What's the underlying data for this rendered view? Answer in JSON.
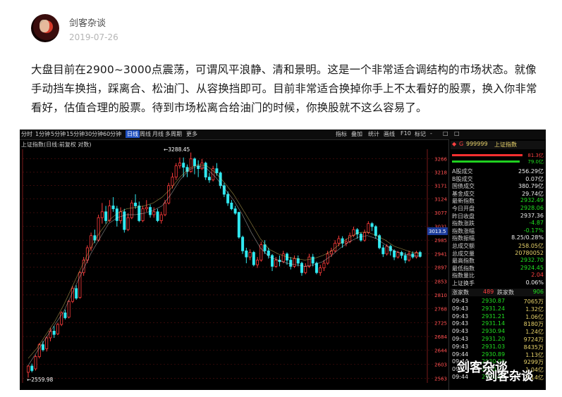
{
  "post": {
    "author": "剑客杂谈",
    "date": "2019-07-26",
    "paragraph": "大盘目前在2900~3000点震荡，可谓风平浪静、清和景明。这是一个非常适合调结构的市场状态。就像手动挡车换挡，踩离合、松油门、从容换挡即可。目前非常适合换掉你手上不太看好的股票，换入你非常看好，估值合理的股票。待到市场松离合给油门的时候，你换股就不这么容易了。"
  },
  "terminal": {
    "tabs": [
      "分时",
      "1分钟",
      "5分钟",
      "15分钟",
      "30分钟",
      "60分钟",
      "日线",
      "周线",
      "月线",
      "多周期",
      "更多"
    ],
    "active_tab": "日线",
    "right_tabs": [
      "指标",
      "叠加",
      "统计",
      "画线",
      "F10",
      "标记",
      "-",
      "□",
      "□"
    ],
    "subtitle": "上证指数(日线:前复权 对数)",
    "high_label": "3288.45",
    "low_label": "2559.98",
    "current_price_label": "3013.5",
    "y_axis_labels": [
      "3266",
      "3218",
      "3171",
      "3124",
      "3077",
      "3031",
      "2985",
      "2941",
      "2897",
      "2853",
      "2810",
      "2768",
      "2725",
      "2684",
      "2644",
      "2603",
      "2563"
    ],
    "panel": {
      "code": "999999",
      "name": "上证指数",
      "ratio_red": "81.3亿",
      "ratio_green": "79.0亿",
      "rows": [
        {
          "label": "A股成交",
          "value": "256.29亿",
          "color": "#f0f0f0"
        },
        {
          "label": "B股成交",
          "value": "0.07亿",
          "color": "#f0f0f0"
        },
        {
          "label": "国债成交",
          "value": "380.79亿",
          "color": "#f0f0f0"
        },
        {
          "label": "基金成交",
          "value": "29.74亿",
          "color": "#f0f0f0"
        },
        {
          "label": "最新指数",
          "value": "2932.49",
          "color": "#20e020"
        },
        {
          "label": "今日开盘",
          "value": "2928.06",
          "color": "#20e020"
        },
        {
          "label": "昨日收盘",
          "value": "2937.36",
          "color": "#f0f0f0"
        },
        {
          "label": "指数涨跌",
          "value": "-4.87",
          "color": "#20e020"
        },
        {
          "label": "指数涨幅",
          "value": "-0.17%",
          "color": "#20e020"
        },
        {
          "label": "指数振幅",
          "value": "8.25/0.28%",
          "color": "#f0f0f0"
        },
        {
          "label": "总成交额",
          "value": "258.05亿",
          "color": "#e9d36a"
        },
        {
          "label": "总成交量",
          "value": "20780052",
          "color": "#e9d36a"
        },
        {
          "label": "最高指数",
          "value": "2932.70",
          "color": "#20e020"
        },
        {
          "label": "最低指数",
          "value": "2924.45",
          "color": "#20e020"
        },
        {
          "label": "指数量比",
          "value": "2.04",
          "color": "#ff4040"
        },
        {
          "label": "上证换手",
          "value": "0.06%",
          "color": "#f0f0f0"
        }
      ],
      "updown": {
        "up_label": "涨家数",
        "up": "489",
        "down_label": "跌家数",
        "down": "906"
      },
      "ticks": [
        {
          "t": "09:43",
          "p": "2930.87",
          "v": "7065万"
        },
        {
          "t": "09:43",
          "p": "2931.24",
          "v": "1.32亿"
        },
        {
          "t": "09:43",
          "p": "2931.21",
          "v": "1.06亿"
        },
        {
          "t": "09:43",
          "p": "2931.14",
          "v": "8180万"
        },
        {
          "t": "09:43",
          "p": "2930.94",
          "v": "1.24亿"
        },
        {
          "t": "09:43",
          "p": "2931.20",
          "v": "9724万"
        },
        {
          "t": "09:43",
          "p": "2931.03",
          "v": "8435万"
        },
        {
          "t": "09:44",
          "p": "2930.89",
          "v": "1.13亿"
        },
        {
          "t": "09:44",
          "p": "2930.98",
          "v": "9299万"
        },
        {
          "t": "09:44",
          "p": "2930.91",
          "v": "1.04亿"
        },
        {
          "t": "09:44",
          "p": "2930.97",
          "v": "1.14亿"
        }
      ]
    },
    "candles": [
      [
        2580,
        2598,
        2565,
        2600
      ],
      [
        2598,
        2585,
        2580,
        2605
      ],
      [
        2590,
        2625,
        2585,
        2630
      ],
      [
        2625,
        2660,
        2620,
        2665
      ],
      [
        2660,
        2645,
        2640,
        2670
      ],
      [
        2648,
        2680,
        2640,
        2685
      ],
      [
        2680,
        2700,
        2670,
        2710
      ],
      [
        2700,
        2690,
        2680,
        2715
      ],
      [
        2692,
        2720,
        2688,
        2725
      ],
      [
        2720,
        2755,
        2715,
        2760
      ],
      [
        2755,
        2740,
        2735,
        2765
      ],
      [
        2742,
        2790,
        2738,
        2795
      ],
      [
        2790,
        2830,
        2785,
        2838
      ],
      [
        2830,
        2800,
        2795,
        2840
      ],
      [
        2802,
        2880,
        2798,
        2885
      ],
      [
        2880,
        2920,
        2870,
        2930
      ],
      [
        2920,
        2960,
        2910,
        2968
      ],
      [
        2960,
        3000,
        2950,
        3010
      ],
      [
        3000,
        2985,
        2975,
        3020
      ],
      [
        2985,
        3060,
        2980,
        3070
      ],
      [
        3060,
        3080,
        3040,
        3110
      ],
      [
        3080,
        3050,
        3040,
        3100
      ],
      [
        3050,
        3100,
        3045,
        3120
      ],
      [
        3100,
        3090,
        3080,
        3130
      ],
      [
        3090,
        3050,
        3030,
        3100
      ],
      [
        3050,
        3080,
        3040,
        3095
      ],
      [
        3080,
        3020,
        3010,
        3090
      ],
      [
        3020,
        3060,
        3015,
        3075
      ],
      [
        3060,
        3110,
        3055,
        3120
      ],
      [
        3110,
        3100,
        3090,
        3140
      ],
      [
        3100,
        3050,
        3045,
        3115
      ],
      [
        3050,
        3090,
        3045,
        3100
      ],
      [
        3090,
        3095,
        3080,
        3120
      ],
      [
        3095,
        3070,
        3060,
        3105
      ],
      [
        3070,
        3080,
        3060,
        3095
      ],
      [
        3080,
        3050,
        3045,
        3090
      ],
      [
        3050,
        3070,
        3040,
        3080
      ],
      [
        3070,
        3110,
        3065,
        3120
      ],
      [
        3110,
        3170,
        3105,
        3180
      ],
      [
        3170,
        3200,
        3160,
        3215
      ],
      [
        3200,
        3240,
        3190,
        3250
      ],
      [
        3240,
        3250,
        3230,
        3270
      ],
      [
        3250,
        3235,
        3200,
        3270
      ],
      [
        3235,
        3220,
        3200,
        3245
      ],
      [
        3220,
        3265,
        3215,
        3288
      ],
      [
        3265,
        3240,
        3210,
        3270
      ],
      [
        3240,
        3230,
        3200,
        3260
      ],
      [
        3230,
        3250,
        3225,
        3265
      ],
      [
        3250,
        3200,
        3190,
        3255
      ],
      [
        3200,
        3190,
        3180,
        3215
      ],
      [
        3190,
        3230,
        3185,
        3240
      ],
      [
        3230,
        3215,
        3205,
        3250
      ],
      [
        3215,
        3170,
        3160,
        3220
      ],
      [
        3170,
        3140,
        3130,
        3180
      ],
      [
        3140,
        3110,
        3100,
        3150
      ],
      [
        3110,
        3090,
        3085,
        3120
      ],
      [
        3090,
        3075,
        3070,
        3100
      ],
      [
        3078,
        2995,
        2990,
        3080
      ],
      [
        2995,
        2950,
        2940,
        3000
      ],
      [
        2950,
        2930,
        2910,
        2960
      ],
      [
        2930,
        2945,
        2920,
        2955
      ],
      [
        2945,
        2905,
        2900,
        2950
      ],
      [
        2905,
        2920,
        2895,
        2930
      ],
      [
        2920,
        2970,
        2915,
        2980
      ],
      [
        2970,
        2950,
        2940,
        2985
      ],
      [
        2950,
        2935,
        2925,
        2960
      ],
      [
        2935,
        2900,
        2885,
        2940
      ],
      [
        2900,
        2920,
        2895,
        2930
      ],
      [
        2920,
        2915,
        2900,
        2935
      ],
      [
        2915,
        2940,
        2910,
        2950
      ],
      [
        2940,
        2920,
        2905,
        2945
      ],
      [
        2920,
        2900,
        2890,
        2930
      ],
      [
        2900,
        2925,
        2895,
        2935
      ],
      [
        2925,
        2910,
        2900,
        2935
      ],
      [
        2910,
        2880,
        2870,
        2915
      ],
      [
        2880,
        2900,
        2875,
        2910
      ],
      [
        2900,
        2930,
        2895,
        2940
      ],
      [
        2930,
        2910,
        2900,
        2940
      ],
      [
        2910,
        2880,
        2875,
        2915
      ],
      [
        2880,
        2895,
        2870,
        2905
      ],
      [
        2895,
        2910,
        2885,
        2920
      ],
      [
        2910,
        2940,
        2905,
        2950
      ],
      [
        2940,
        2950,
        2930,
        2960
      ],
      [
        2950,
        2975,
        2945,
        2985
      ],
      [
        2975,
        2990,
        2965,
        3000
      ],
      [
        2990,
        2975,
        2960,
        2998
      ],
      [
        2975,
        2980,
        2965,
        2990
      ],
      [
        2980,
        3000,
        2975,
        3010
      ],
      [
        3000,
        3020,
        2995,
        3030
      ],
      [
        3020,
        3005,
        2990,
        3025
      ],
      [
        3005,
        2985,
        2980,
        3010
      ],
      [
        2985,
        3010,
        2980,
        3020
      ],
      [
        3010,
        3040,
        3005,
        3048
      ],
      [
        3040,
        3030,
        3015,
        3045
      ],
      [
        3030,
        3000,
        2990,
        3035
      ],
      [
        3000,
        2960,
        2955,
        3005
      ],
      [
        2960,
        2940,
        2930,
        2970
      ],
      [
        2940,
        2965,
        2935,
        2972
      ],
      [
        2965,
        2950,
        2935,
        2970
      ],
      [
        2950,
        2930,
        2920,
        2955
      ],
      [
        2930,
        2945,
        2925,
        2950
      ],
      [
        2945,
        2935,
        2925,
        2950
      ],
      [
        2935,
        2920,
        2910,
        2945
      ],
      [
        2920,
        2940,
        2915,
        2950
      ],
      [
        2940,
        2930,
        2925,
        2948
      ],
      [
        2930,
        2945,
        2925,
        2950
      ],
      [
        2945,
        2932,
        2928,
        2950
      ]
    ],
    "ma_line": [
      2600,
      2640,
      2680,
      2720,
      2760,
      2820,
      2880,
      2940,
      2990,
      3040,
      3060,
      3070,
      3070,
      3075,
      3085,
      3100,
      3140,
      3190,
      3225,
      3240,
      3230,
      3200,
      3160,
      3120,
      3070,
      3010,
      2960,
      2930,
      2920,
      2910,
      2905,
      2900,
      2905,
      2915,
      2935,
      2960,
      2980,
      2995,
      3000,
      2990,
      2970,
      2950,
      2940,
      2935,
      2932
    ],
    "ma_line2": [
      2620,
      2650,
      2690,
      2730,
      2780,
      2840,
      2900,
      2960,
      3010,
      3050,
      3075,
      3090,
      3095,
      3100,
      3110,
      3130,
      3160,
      3200,
      3230,
      3245,
      3240,
      3215,
      3180,
      3140,
      3090,
      3040,
      2990,
      2955,
      2940,
      2930,
      2925,
      2920,
      2925,
      2935,
      2950,
      2975,
      2995,
      3010,
      3012,
      3000,
      2985,
      2965,
      2955,
      2945,
      2940
    ],
    "colors": {
      "up": "#ff3b3b",
      "down": "#30e8f0",
      "ma1": "#e0e0e0",
      "ma2": "#e9d36a",
      "grid": "#5a1010"
    }
  },
  "watermark": {
    "text": "剑客杂谈"
  }
}
